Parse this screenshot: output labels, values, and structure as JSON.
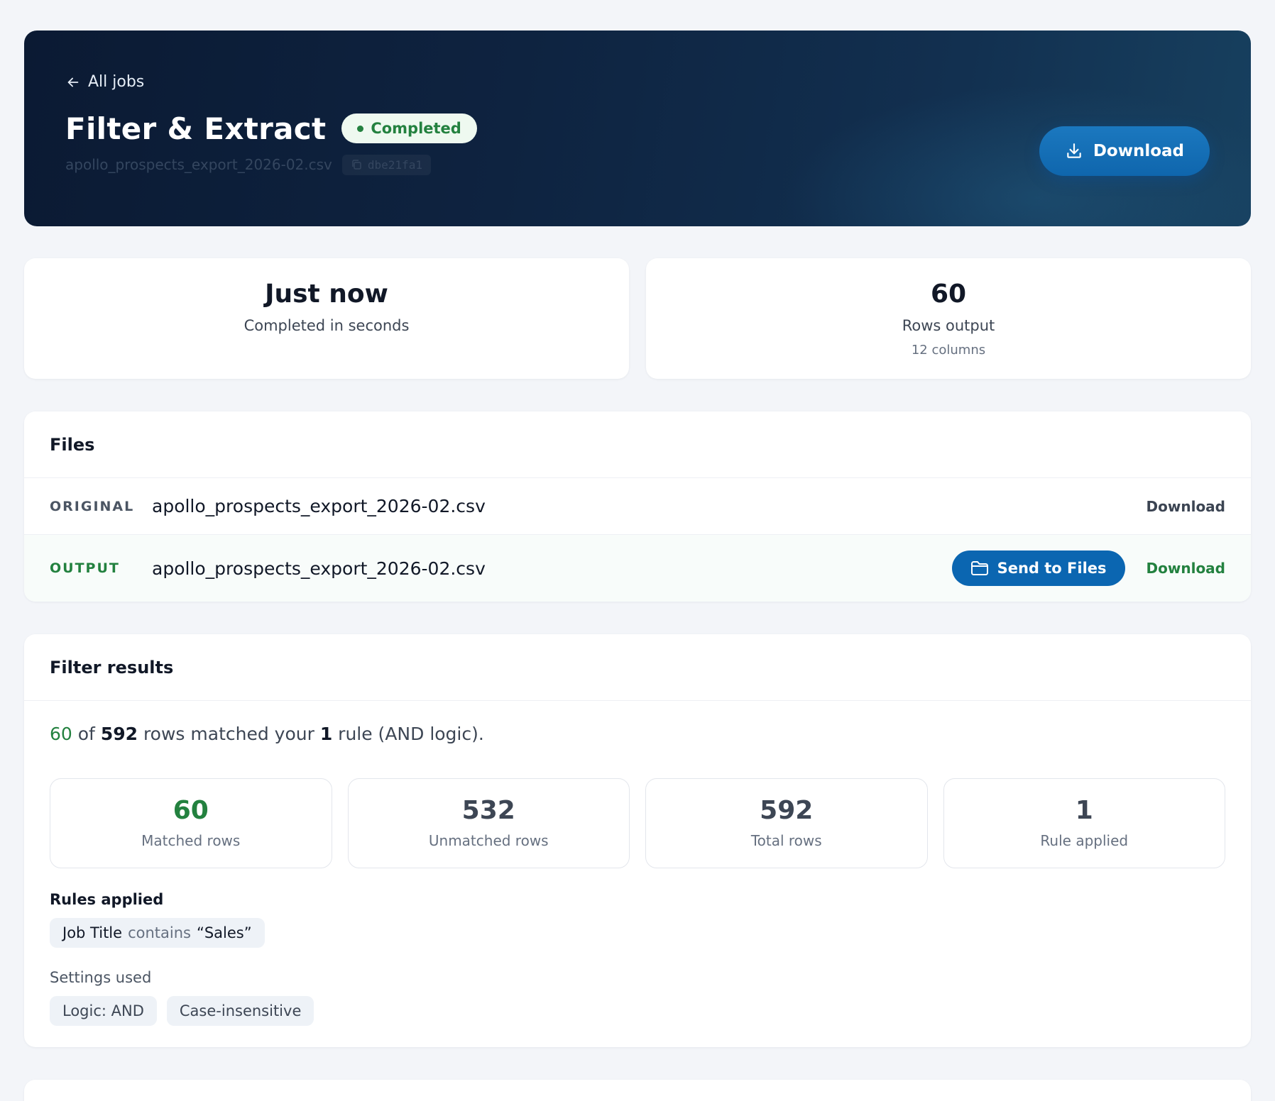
{
  "header": {
    "back_label": "All jobs",
    "title": "Filter & Extract",
    "status": "Completed",
    "filename": "apollo_prospects_export_2026-02.csv",
    "job_id": "dbe21fa1",
    "download_label": "Download"
  },
  "stats": {
    "time": {
      "value": "Just now",
      "label": "Completed in seconds"
    },
    "rows": {
      "value": "60",
      "label": "Rows output",
      "sub": "12 columns"
    }
  },
  "files": {
    "title": "Files",
    "original": {
      "kind": "ORIGINAL",
      "name": "apollo_prospects_export_2026-02.csv",
      "download_label": "Download"
    },
    "output": {
      "kind": "OUTPUT",
      "name": "apollo_prospects_export_2026-02.csv",
      "send_label": "Send to Files",
      "download_label": "Download"
    }
  },
  "filter": {
    "title": "Filter results",
    "summary": {
      "matched": "60",
      "of": " of ",
      "total": "592",
      "mid": " rows matched your ",
      "rules": "1",
      "tail": " rule (AND logic)."
    },
    "metrics": [
      {
        "value": "60",
        "label": "Matched rows"
      },
      {
        "value": "532",
        "label": "Unmatched rows"
      },
      {
        "value": "592",
        "label": "Total rows"
      },
      {
        "value": "1",
        "label": "Rule applied"
      }
    ],
    "rules_title": "Rules applied",
    "rule": {
      "field": "Job Title",
      "operator": "contains",
      "value": "“Sales”"
    },
    "settings_title": "Settings used",
    "settings": [
      "Logic: AND",
      "Case-insensitive"
    ]
  },
  "colors": {
    "accent_blue": "#0b66b1",
    "success_green": "#23813f",
    "hero_bg": "#0b1a33"
  }
}
